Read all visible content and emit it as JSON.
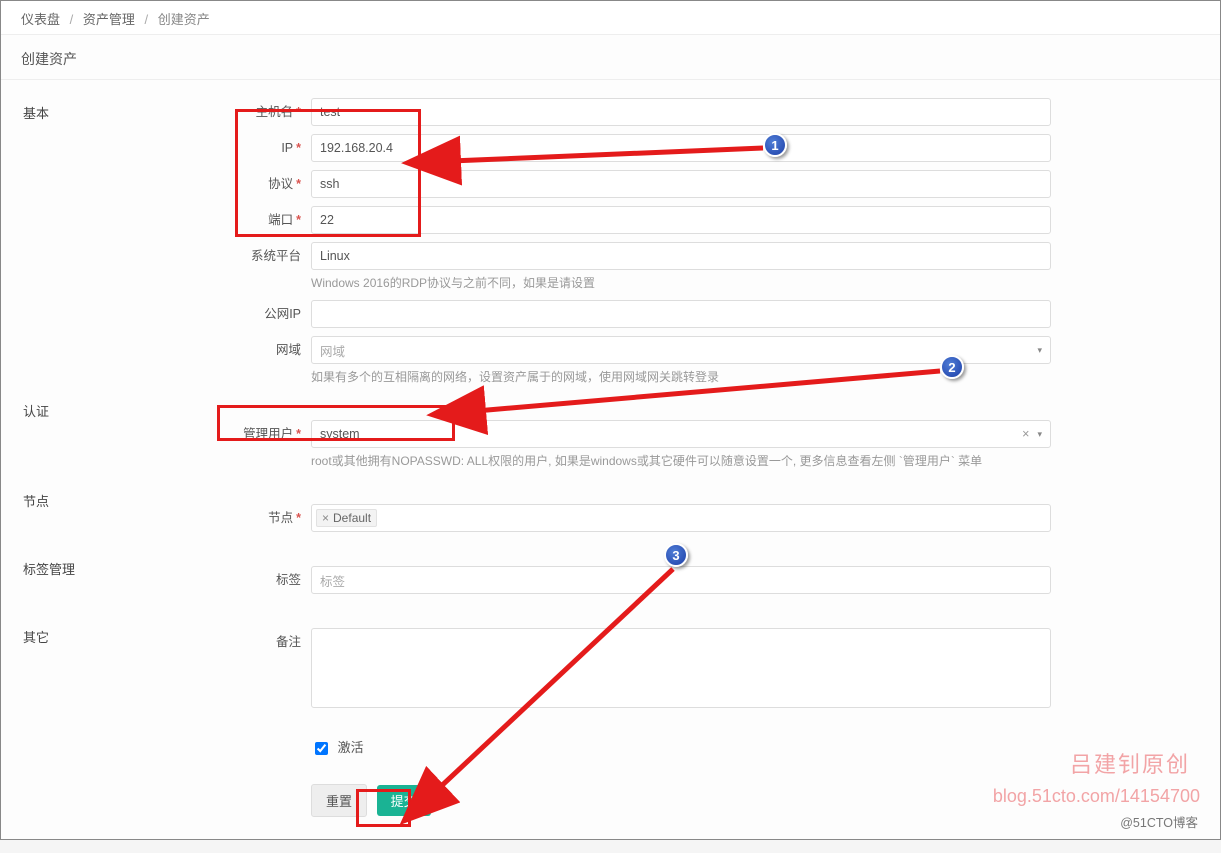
{
  "breadcrumb": {
    "dashboard": "仪表盘",
    "asset_mgmt": "资产管理",
    "current": "创建资产"
  },
  "page_title": "创建资产",
  "sections": {
    "basic": "基本",
    "auth": "认证",
    "node": "节点",
    "tag_mgmt": "标签管理",
    "other": "其它"
  },
  "labels": {
    "hostname": "主机名",
    "ip": "IP",
    "protocol": "协议",
    "port": "端口",
    "platform": "系统平台",
    "public_ip": "公网IP",
    "domain": "网域",
    "admin_user": "管理用户",
    "node": "节点",
    "tags": "标签",
    "comment": "备注",
    "active": "激活"
  },
  "values": {
    "hostname": "test",
    "ip": "192.168.20.4",
    "protocol": "ssh",
    "port": "22",
    "platform": "Linux",
    "public_ip": "",
    "admin_user": "system",
    "node_tag": "Default",
    "tags_placeholder": "标签",
    "domain_placeholder": "网域",
    "active_checked": true
  },
  "help": {
    "platform": "Windows 2016的RDP协议与之前不同，如果是请设置",
    "domain": "如果有多个的互相隔离的网络，设置资产属于的网域，使用网域网关跳转登录",
    "admin_user": "root或其他拥有NOPASSWD: ALL权限的用户, 如果是windows或其它硬件可以随意设置一个, 更多信息查看左侧 `管理用户` 菜单"
  },
  "buttons": {
    "reset": "重置",
    "submit": "提交"
  },
  "callouts": {
    "c1": "1",
    "c2": "2",
    "c3": "3"
  },
  "watermark": {
    "line1": "吕建钊原创",
    "line2": "blog.51cto.com/14154700",
    "attribution": "@51CTO博客"
  }
}
